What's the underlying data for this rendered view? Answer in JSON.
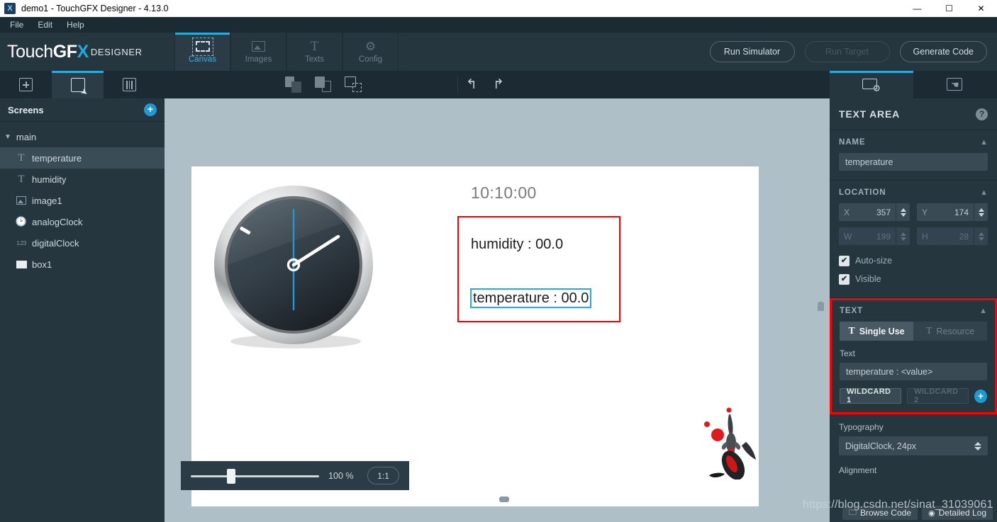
{
  "window": {
    "title": "demo1 - TouchGFX Designer - 4.13.0",
    "app_icon": "touchgfx-app-icon",
    "minimize": "—",
    "maximize": "☐",
    "close": "✕"
  },
  "menu": {
    "items": [
      {
        "label": "File"
      },
      {
        "label": "Edit"
      },
      {
        "label": "Help"
      }
    ]
  },
  "brand": {
    "part1": "Touch",
    "part2": "GF",
    "part3": "X",
    "sub": "DESIGNER"
  },
  "mode_tabs": [
    {
      "label": "Canvas",
      "icon": "dashed-rect-icon",
      "active": true
    },
    {
      "label": "Images",
      "icon": "image-icon",
      "active": false
    },
    {
      "label": "Texts",
      "icon": "text-t-icon",
      "active": false
    },
    {
      "label": "Config",
      "icon": "gear-icon",
      "active": false
    }
  ],
  "top_actions": [
    {
      "label": "Run Simulator",
      "enabled": true
    },
    {
      "label": "Run Target",
      "enabled": false
    },
    {
      "label": "Generate Code",
      "enabled": true
    }
  ],
  "toolbar": {
    "add_widget": "add-widget-icon",
    "select_screen": "screen-cursor-icon",
    "mixer": "mixer-icon",
    "bring_front": "bring-to-front-icon",
    "send_back": "send-to-back-icon",
    "select_all": "select-region-icon",
    "undo": "↰",
    "redo": "↱"
  },
  "sidebar": {
    "title": "Screens",
    "add_label": "+",
    "root": {
      "label": "main",
      "expanded": true
    },
    "items": [
      {
        "label": "temperature",
        "icon": "text-icon",
        "selected": true
      },
      {
        "label": "humidity",
        "icon": "text-icon",
        "selected": false
      },
      {
        "label": "image1",
        "icon": "image-icon",
        "selected": false
      },
      {
        "label": "analogClock",
        "icon": "clock-icon",
        "selected": false
      },
      {
        "label": "digitalClock",
        "icon": "digits-icon",
        "selected": false
      },
      {
        "label": "box1",
        "icon": "box-icon",
        "selected": false
      }
    ]
  },
  "canvas": {
    "digital_clock": "10:10:00",
    "humidity_text": "humidity :  00.0",
    "temperature_text": "temperature :  00.0",
    "selection_color": "#2aa9e0",
    "group_box_color": "#ff0000",
    "zoom": {
      "value": "100 %",
      "ratio_label": "1:1"
    }
  },
  "properties": {
    "tabs": [
      {
        "icon": "screen-gear-icon",
        "active": true
      },
      {
        "icon": "screen-hand-icon",
        "active": false
      }
    ],
    "header": "TEXT AREA",
    "help": "?",
    "name_section": {
      "title": "NAME",
      "value": "temperature"
    },
    "location_section": {
      "title": "LOCATION",
      "x_label": "X",
      "x_value": "357",
      "y_label": "Y",
      "y_value": "174",
      "w_label": "W",
      "w_value": "199",
      "h_label": "H",
      "h_value": "28",
      "autosize_label": "Auto-size",
      "autosize_checked": "✔",
      "visible_label": "Visible",
      "visible_checked": "✔"
    },
    "text_section": {
      "title": "TEXT",
      "single_use": "Single Use",
      "resource": "Resource",
      "text_label": "Text",
      "text_value": "temperature :  <value>",
      "wildcard1": "WILDCARD 1",
      "wildcard2": "WILDCARD 2",
      "add_wildcard": "+"
    },
    "typography_section": {
      "label": "Typography",
      "value": "DigitalClock,  24px",
      "alignment_label": "Alignment"
    }
  },
  "statusbar": {
    "browse_code": "Browse Code",
    "detailed_log": "Detailed Log"
  },
  "watermark": "https://blog.csdn.net/sinat_31039061"
}
